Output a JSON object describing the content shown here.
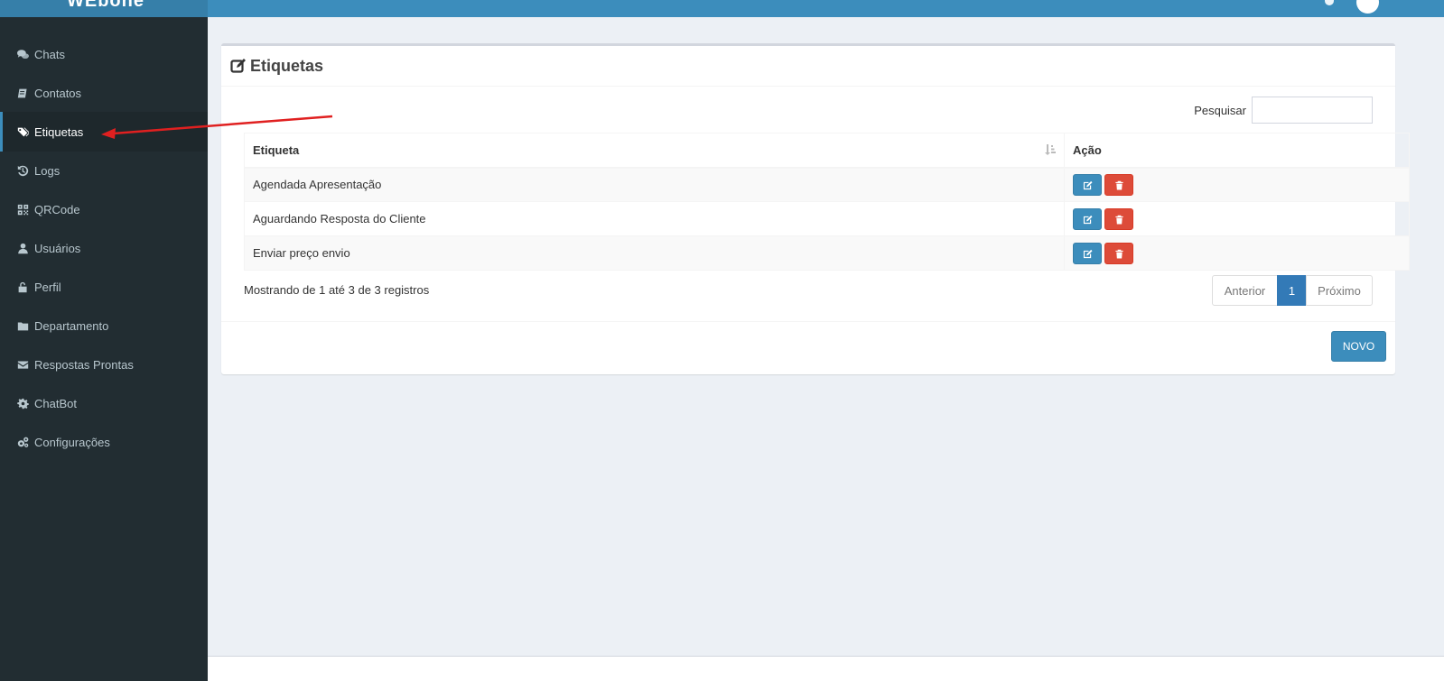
{
  "app": {
    "logo_text": "WEbone"
  },
  "sidebar": {
    "items": [
      {
        "label": "Chats",
        "icon": "chats-icon"
      },
      {
        "label": "Contatos",
        "icon": "book-icon"
      },
      {
        "label": "Etiquetas",
        "icon": "tags-icon",
        "active": true
      },
      {
        "label": "Logs",
        "icon": "history-icon"
      },
      {
        "label": "QRCode",
        "icon": "qrcode-icon"
      },
      {
        "label": "Usuários",
        "icon": "user-icon"
      },
      {
        "label": "Perfil",
        "icon": "unlock-icon"
      },
      {
        "label": "Departamento",
        "icon": "folder-icon"
      },
      {
        "label": "Respostas Prontas",
        "icon": "envelope-icon"
      },
      {
        "label": "ChatBot",
        "icon": "cog-icon"
      },
      {
        "label": "Configurações",
        "icon": "cogs-icon"
      }
    ]
  },
  "main": {
    "title": "Etiquetas",
    "title_icon": "edit-square-icon",
    "search": {
      "label": "Pesquisar",
      "value": ""
    },
    "table": {
      "columns": [
        "Etiqueta",
        "Ação"
      ],
      "rows": [
        {
          "etiqueta": "Agendada Apresentação"
        },
        {
          "etiqueta": "Aguardando Resposta do Cliente"
        },
        {
          "etiqueta": "Enviar preço envio"
        }
      ]
    },
    "info": "Mostrando de 1 até 3 de 3 registros",
    "pagination": {
      "prev": "Anterior",
      "current": "1",
      "next": "Próximo"
    },
    "new_button": "NOVO"
  },
  "colors": {
    "primary": "#3c8dbc",
    "danger": "#dd4b39",
    "sidebar_bg": "#222d32",
    "annotation_arrow": "#e02020"
  }
}
